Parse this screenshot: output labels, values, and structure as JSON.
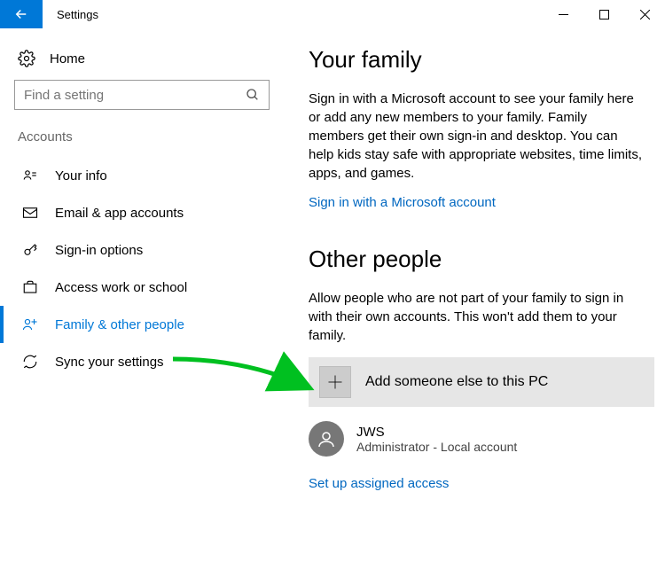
{
  "window": {
    "title": "Settings"
  },
  "sidebar": {
    "home": "Home",
    "search_placeholder": "Find a setting",
    "category": "Accounts",
    "items": [
      {
        "label": "Your info"
      },
      {
        "label": "Email & app accounts"
      },
      {
        "label": "Sign-in options"
      },
      {
        "label": "Access work or school"
      },
      {
        "label": "Family & other people"
      },
      {
        "label": "Sync your settings"
      }
    ]
  },
  "main": {
    "section1_title": "Your family",
    "section1_body": "Sign in with a Microsoft account to see your family here or add any new members to your family. Family members get their own sign-in and desktop. You can help kids stay safe with appropriate websites, time limits, apps, and games.",
    "section1_link": "Sign in with a Microsoft account",
    "section2_title": "Other people",
    "section2_body": "Allow people who are not part of your family to sign in with their own accounts. This won't add them to your family.",
    "add_label": "Add someone else to this PC",
    "user": {
      "name": "JWS",
      "subtitle": "Administrator - Local account"
    },
    "assigned_link": "Set up assigned access"
  }
}
